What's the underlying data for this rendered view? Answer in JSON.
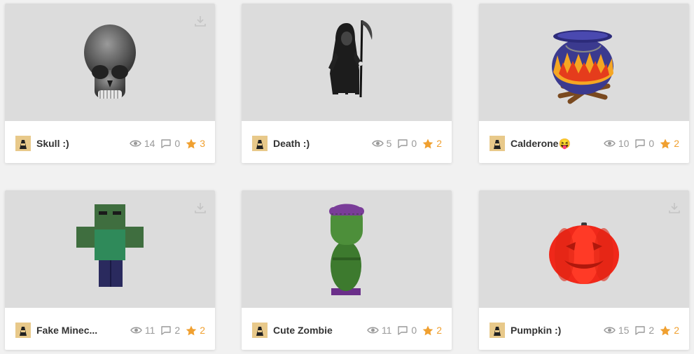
{
  "colors": {
    "page_bg": "#f1f1f1",
    "thumb_bg": "#dcdcdc",
    "star": "#f0a030",
    "muted": "#999999"
  },
  "icons": {
    "views": "eye-icon",
    "comments": "comment-icon",
    "likes": "star-icon",
    "download": "download-icon",
    "avatar": "user-avatar"
  },
  "cards": [
    {
      "title": "Skull :)",
      "views": "14",
      "comments": "0",
      "likes": "3",
      "model": "skull"
    },
    {
      "title": "Death :)",
      "views": "5",
      "comments": "0",
      "likes": "2",
      "model": "reaper"
    },
    {
      "title": "Calderone😝",
      "views": "10",
      "comments": "0",
      "likes": "2",
      "model": "cauldron"
    },
    {
      "title": "Fake Minec...",
      "views": "11",
      "comments": "2",
      "likes": "2",
      "model": "minecraft-zombie"
    },
    {
      "title": "Cute Zombie",
      "views": "11",
      "comments": "0",
      "likes": "2",
      "model": "cute-zombie"
    },
    {
      "title": "Pumpkin :)",
      "views": "15",
      "comments": "2",
      "likes": "2",
      "model": "pumpkin"
    }
  ]
}
